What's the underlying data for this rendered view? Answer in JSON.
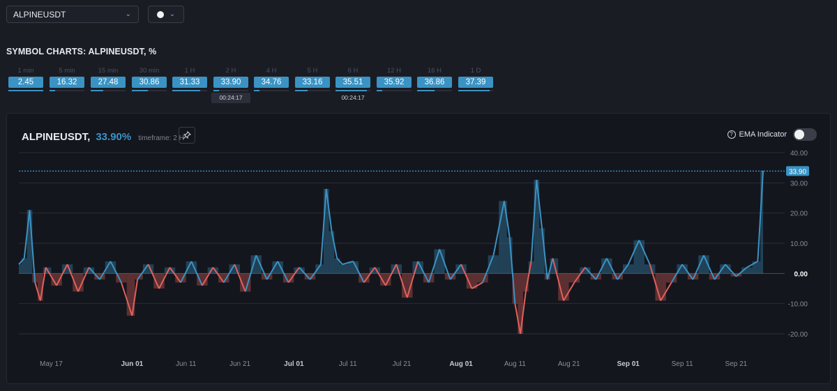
{
  "symbol_select": {
    "value": "ALPINEUSDT"
  },
  "color_select": {
    "color": "#f2f2f2"
  },
  "section_title": "SYMBOL CHARTS: ALPINEUSDT, %",
  "timeframes": [
    {
      "label": "1 min",
      "value": "2.45",
      "progress": 1.0
    },
    {
      "label": "5 min",
      "value": "16.32",
      "progress": 0.15
    },
    {
      "label": "15 min",
      "value": "27.48",
      "progress": 0.35
    },
    {
      "label": "30 min",
      "value": "30.86",
      "progress": 0.45
    },
    {
      "label": "1 H",
      "value": "31.33",
      "progress": 0.8
    },
    {
      "label": "2 H",
      "value": "33.90",
      "progress": 0.15,
      "timer": "00:24:17",
      "selected": true
    },
    {
      "label": "4 H",
      "value": "34.76",
      "progress": 0.15
    },
    {
      "label": "5 H",
      "value": "33.16",
      "progress": 0.35
    },
    {
      "label": "6 H",
      "value": "35.51",
      "progress": 0.9,
      "timer": "00:24:17"
    },
    {
      "label": "12 H",
      "value": "35.92",
      "progress": 0.15
    },
    {
      "label": "16 H",
      "value": "36.86",
      "progress": 0.5
    },
    {
      "label": "1 D",
      "value": "37.39",
      "progress": 0.9
    }
  ],
  "chart_header": {
    "symbol": "ALPINEUSDT,",
    "value": "33.90%",
    "timeframe": "timeframe: 2 H",
    "ema_label": "EMA Indicator",
    "ema_enabled": false
  },
  "colors": {
    "positive": "#3a93c4",
    "negative": "#e2605b",
    "accent": "#3a93c4",
    "background": "#14161d"
  },
  "chart_data": {
    "type": "area",
    "title": "",
    "xlabel": "",
    "ylabel": "",
    "ylim": [
      -24,
      44
    ],
    "y_ticks": [
      "40.00",
      "30.00",
      "20.00",
      "10.00",
      "0.00",
      "-10.00",
      "-20.00"
    ],
    "x_ticks": [
      "May 17",
      "Jun 01",
      "Jun 11",
      "Jun 21",
      "Jul 01",
      "Jul 11",
      "Jul 21",
      "Aug 01",
      "Aug 11",
      "Aug 21",
      "Sep 01",
      "Sep 11",
      "Sep 21"
    ],
    "current_value": 33.9,
    "current_label": "33.90",
    "x_start": "May 11",
    "x_end": "Sep 30",
    "series": [
      {
        "points": [
          [
            "May 11",
            3
          ],
          [
            "May 12",
            5
          ],
          [
            "May 13",
            21
          ],
          [
            "May 14",
            -3
          ],
          [
            "May 15",
            -9
          ],
          [
            "May 16",
            2
          ],
          [
            "May 18",
            -4
          ],
          [
            "May 20",
            3
          ],
          [
            "May 22",
            -6
          ],
          [
            "May 24",
            2
          ],
          [
            "May 26",
            -2
          ],
          [
            "May 28",
            4
          ],
          [
            "May 30",
            -3
          ],
          [
            "Jun 01",
            -14
          ],
          [
            "Jun 02",
            -2
          ],
          [
            "Jun 04",
            3
          ],
          [
            "Jun 06",
            -5
          ],
          [
            "Jun 08",
            2
          ],
          [
            "Jun 10",
            -3
          ],
          [
            "Jun 12",
            4
          ],
          [
            "Jun 14",
            -4
          ],
          [
            "Jun 16",
            2
          ],
          [
            "Jun 18",
            -3
          ],
          [
            "Jun 20",
            3
          ],
          [
            "Jun 22",
            -6
          ],
          [
            "Jun 24",
            6
          ],
          [
            "Jun 26",
            -2
          ],
          [
            "Jun 28",
            4
          ],
          [
            "Jun 30",
            -3
          ],
          [
            "Jul 02",
            2
          ],
          [
            "Jul 04",
            -2
          ],
          [
            "Jul 06",
            3
          ],
          [
            "Jul 07",
            28
          ],
          [
            "Jul 08",
            14
          ],
          [
            "Jul 09",
            5
          ],
          [
            "Jul 10",
            3
          ],
          [
            "Jul 12",
            4
          ],
          [
            "Jul 14",
            -3
          ],
          [
            "Jul 16",
            2
          ],
          [
            "Jul 18",
            -4
          ],
          [
            "Jul 20",
            3
          ],
          [
            "Jul 22",
            -8
          ],
          [
            "Jul 24",
            4
          ],
          [
            "Jul 26",
            -3
          ],
          [
            "Jul 28",
            8
          ],
          [
            "Jul 30",
            -2
          ],
          [
            "Aug 01",
            3
          ],
          [
            "Aug 03",
            -5
          ],
          [
            "Aug 05",
            -3
          ],
          [
            "Aug 07",
            6
          ],
          [
            "Aug 09",
            24
          ],
          [
            "Aug 10",
            12
          ],
          [
            "Aug 11",
            -10
          ],
          [
            "Aug 12",
            -20
          ],
          [
            "Aug 13",
            -6
          ],
          [
            "Aug 14",
            4
          ],
          [
            "Aug 15",
            31
          ],
          [
            "Aug 16",
            15
          ],
          [
            "Aug 17",
            -2
          ],
          [
            "Aug 18",
            5
          ],
          [
            "Aug 20",
            -9
          ],
          [
            "Aug 22",
            -3
          ],
          [
            "Aug 24",
            2
          ],
          [
            "Aug 26",
            -2
          ],
          [
            "Aug 28",
            5
          ],
          [
            "Aug 30",
            -2
          ],
          [
            "Sep 01",
            3
          ],
          [
            "Sep 03",
            11
          ],
          [
            "Sep 05",
            3
          ],
          [
            "Sep 07",
            -9
          ],
          [
            "Sep 09",
            -3
          ],
          [
            "Sep 11",
            3
          ],
          [
            "Sep 13",
            -2
          ],
          [
            "Sep 15",
            6
          ],
          [
            "Sep 17",
            -2
          ],
          [
            "Sep 19",
            3
          ],
          [
            "Sep 21",
            -1
          ],
          [
            "Sep 23",
            2
          ],
          [
            "Sep 25",
            4
          ],
          [
            "Sep 26",
            34
          ]
        ]
      }
    ]
  }
}
